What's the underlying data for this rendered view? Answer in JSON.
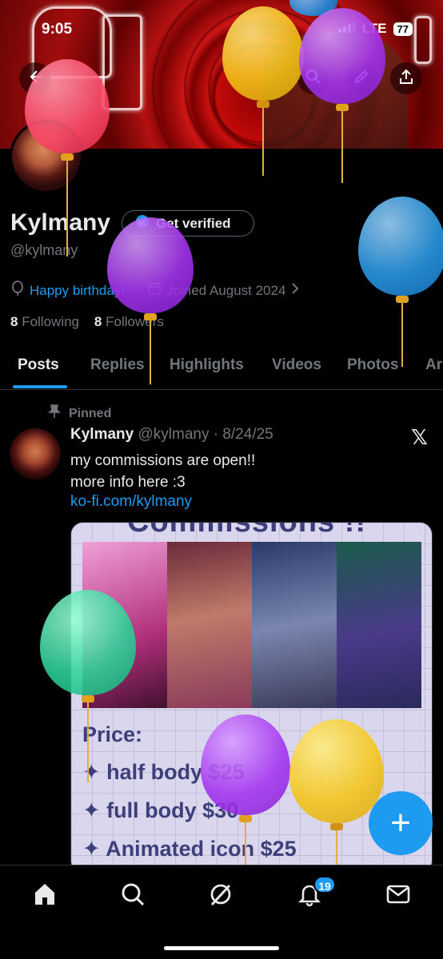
{
  "status": {
    "time": "9:05",
    "network": "LTE",
    "battery": "77"
  },
  "profile": {
    "name": "Kylmany",
    "handle": "@kylmany",
    "verify_label": "Get verified",
    "birthday": "Happy birthday!",
    "joined": "Joined August 2024",
    "following_count": "8",
    "following_label": "Following",
    "followers_count": "8",
    "followers_label": "Followers"
  },
  "tabs": [
    "Posts",
    "Replies",
    "Highlights",
    "Videos",
    "Photos",
    "Ar"
  ],
  "post": {
    "pinned_label": "Pinned",
    "author": "Kylmany",
    "meta": "@kylmany · 8/24/25",
    "text_line1": "my commissions are open!!",
    "text_line2": "more info here :3",
    "link": "ko-fi.com/kylmany"
  },
  "media": {
    "title": "Commissions !!",
    "price_label": "Price:",
    "prices": [
      "✦ half body $25",
      "✦ full body $30",
      "✦ Animated icon $25"
    ]
  },
  "nav": {
    "notification_count": "19"
  },
  "colors": {
    "accent": "#1d9bf0",
    "background": "#000000"
  },
  "icons": [
    "back-icon",
    "search-icon",
    "edit-icon",
    "share-icon",
    "balloon-icon",
    "calendar-icon",
    "pin-icon",
    "x-logo-icon",
    "home-icon",
    "grok-icon",
    "bell-icon",
    "mail-icon",
    "plus-icon"
  ]
}
